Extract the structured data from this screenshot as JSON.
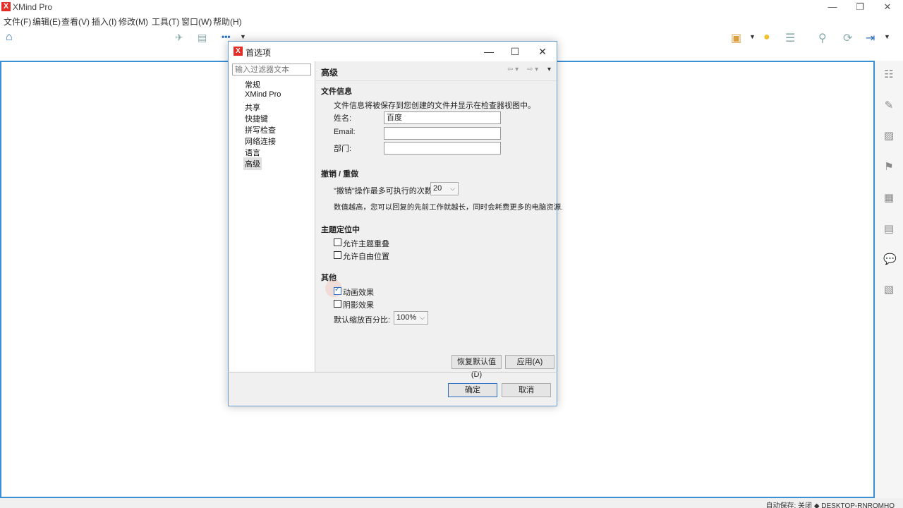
{
  "app": {
    "title": "XMind Pro",
    "logo": "X"
  },
  "window_controls": {
    "minimize": "—",
    "maximize": "❐",
    "close": "✕"
  },
  "menu": [
    "文件(F)",
    "编辑(E)",
    "查看(V)",
    "插入(I)",
    "修改(M)",
    "工具(T)",
    "窗口(W)",
    "帮助(H)"
  ],
  "toolbar": {
    "more": "•••"
  },
  "dialog": {
    "title": "首选项",
    "logo": "X",
    "filter_placeholder": "输入过滤器文本",
    "nav": [
      "常规",
      "XMind Pro",
      "共享",
      "快捷键",
      "拼写检查",
      "网络连接",
      "语言",
      "高级"
    ],
    "selected_nav": "高级",
    "page_title": "高级",
    "file_info": {
      "title": "文件信息",
      "desc": "文件信息将被保存到您创建的文件并显示在检查器视图中。",
      "name_label": "姓名:",
      "name_value": "百度",
      "email_label": "Email:",
      "email_value": "",
      "dept_label": "部门:",
      "dept_value": ""
    },
    "undo": {
      "title": "撤销 / 重做",
      "label": "\"撤销\"操作最多可执行的次数:",
      "value": "20",
      "desc": "数值越高，您可以回复的先前工作就越长，同时会耗费更多的电脑资源."
    },
    "topic_position": {
      "title": "主题定位中",
      "allow_overlap": "允许主题重叠",
      "allow_overlap_checked": false,
      "allow_free": "允许自由位置",
      "allow_free_checked": false
    },
    "other": {
      "title": "其他",
      "animation": "动画效果",
      "animation_checked": true,
      "shadow": "阴影效果",
      "shadow_checked": false,
      "zoom_label": "默认缩放百分比:",
      "zoom_value": "100%"
    },
    "restore_defaults": "恢复默认值(D)",
    "apply": "应用(A)",
    "ok": "确定",
    "cancel": "取消"
  },
  "status": {
    "text": "自动保存: 关闭 ◆ DESKTOP-RNROMHO"
  }
}
